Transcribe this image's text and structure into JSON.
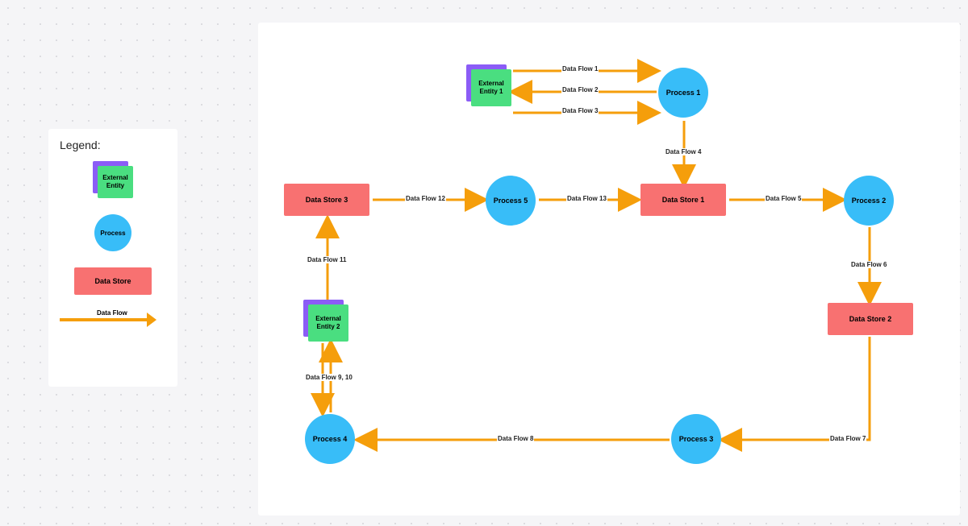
{
  "legend": {
    "title": "Legend:",
    "external_entity": "External Entity",
    "process": "Process",
    "data_store": "Data Store",
    "data_flow": "Data Flow"
  },
  "nodes": {
    "ee1": "External Entity 1",
    "ee2": "External Entity 2",
    "p1": "Process 1",
    "p2": "Process 2",
    "p3": "Process 3",
    "p4": "Process 4",
    "p5": "Process 5",
    "ds1": "Data Store 1",
    "ds2": "Data Store 2",
    "ds3": "Data Store 3"
  },
  "flows": {
    "f1": "Data Flow 1",
    "f2": "Data Flow 2",
    "f3": "Data Flow 3",
    "f4": "Data Flow 4",
    "f5": "Data Flow 5",
    "f6": "Data Flow 6",
    "f7": "Data Flow 7",
    "f8": "Data Flow 8",
    "f9_10": "Data Flow 9, 10",
    "f11": "Data Flow 11",
    "f12": "Data Flow 12",
    "f13": "Data Flow 13"
  },
  "chart_data": {
    "type": "data-flow-diagram",
    "entities": [
      {
        "id": "ee1",
        "type": "external_entity",
        "label": "External Entity 1"
      },
      {
        "id": "ee2",
        "type": "external_entity",
        "label": "External Entity 2"
      },
      {
        "id": "p1",
        "type": "process",
        "label": "Process 1"
      },
      {
        "id": "p2",
        "type": "process",
        "label": "Process 2"
      },
      {
        "id": "p3",
        "type": "process",
        "label": "Process 3"
      },
      {
        "id": "p4",
        "type": "process",
        "label": "Process 4"
      },
      {
        "id": "p5",
        "type": "process",
        "label": "Process 5"
      },
      {
        "id": "ds1",
        "type": "data_store",
        "label": "Data Store 1"
      },
      {
        "id": "ds2",
        "type": "data_store",
        "label": "Data Store 2"
      },
      {
        "id": "ds3",
        "type": "data_store",
        "label": "Data Store 3"
      }
    ],
    "flows": [
      {
        "id": "f1",
        "from": "ee1",
        "to": "p1",
        "label": "Data Flow 1"
      },
      {
        "id": "f2",
        "from": "p1",
        "to": "ee1",
        "label": "Data Flow 2"
      },
      {
        "id": "f3",
        "from": "ee1",
        "to": "p1",
        "label": "Data Flow 3"
      },
      {
        "id": "f4",
        "from": "p1",
        "to": "ds1",
        "label": "Data Flow 4"
      },
      {
        "id": "f5",
        "from": "ds1",
        "to": "p2",
        "label": "Data Flow 5"
      },
      {
        "id": "f6",
        "from": "p2",
        "to": "ds2",
        "label": "Data Flow 6"
      },
      {
        "id": "f7",
        "from": "ds2",
        "to": "p3",
        "label": "Data Flow 7"
      },
      {
        "id": "f8",
        "from": "p3",
        "to": "p4",
        "label": "Data Flow 8"
      },
      {
        "id": "f9_10",
        "from": "p4",
        "to": "ee2",
        "label": "Data Flow 9, 10",
        "bidirectional": true
      },
      {
        "id": "f11",
        "from": "ee2",
        "to": "ds3",
        "label": "Data Flow 11"
      },
      {
        "id": "f12",
        "from": "ds3",
        "to": "p5",
        "label": "Data Flow 12"
      },
      {
        "id": "f13",
        "from": "p5",
        "to": "ds1",
        "label": "Data Flow 13"
      }
    ]
  }
}
